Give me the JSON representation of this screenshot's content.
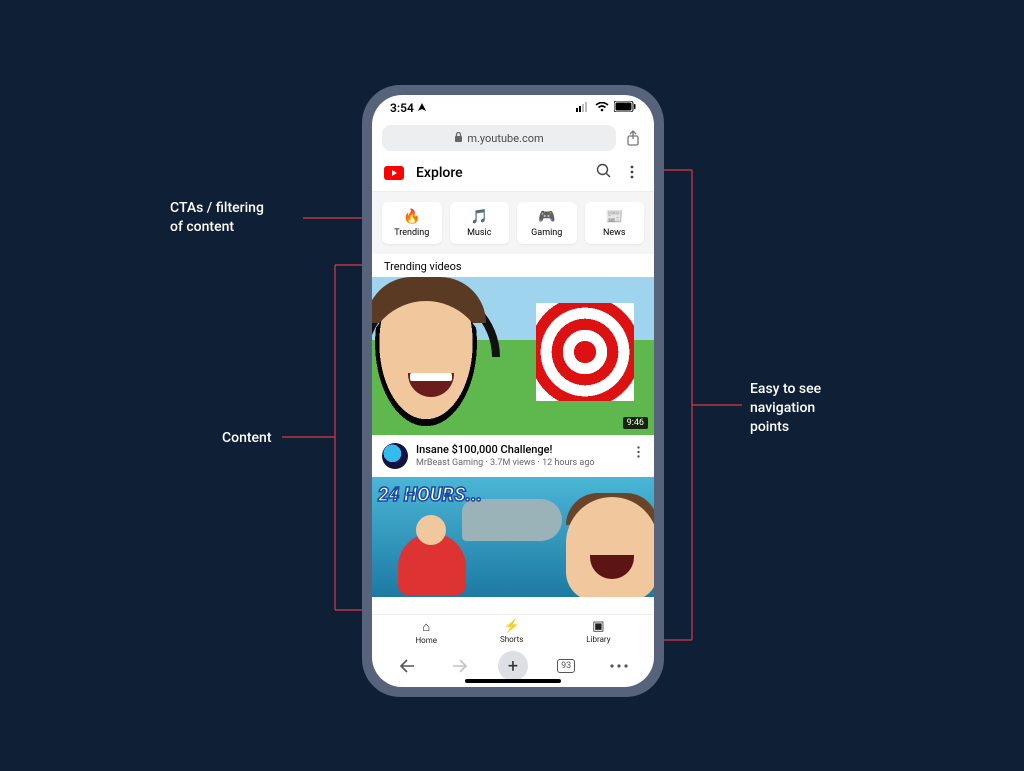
{
  "annotations": {
    "cta": "CTAs / filtering\nof content",
    "content": "Content",
    "nav": "Easy to see\nnavigation\npoints"
  },
  "statusbar": {
    "time": "3:54"
  },
  "browser": {
    "domain": "m.youtube.com",
    "tabs_count": "93"
  },
  "header": {
    "title": "Explore"
  },
  "categories": [
    {
      "icon": "🔥",
      "label": "Trending"
    },
    {
      "icon": "🎵",
      "label": "Music"
    },
    {
      "icon": "🎮",
      "label": "Gaming"
    },
    {
      "icon": "📰",
      "label": "News"
    }
  ],
  "section_title": "Trending videos",
  "videos": [
    {
      "title": "Insane $100,000 Challenge!",
      "channel": "MrBeast Gaming",
      "views": "3.7M views",
      "age": "12 hours ago",
      "duration": "9:46"
    },
    {
      "overlay": "24 HOURS..."
    }
  ],
  "app_tabs": [
    {
      "icon": "⌂",
      "label": "Home"
    },
    {
      "icon": "⚡",
      "label": "Shorts"
    },
    {
      "icon": "▣",
      "label": "Library"
    }
  ]
}
